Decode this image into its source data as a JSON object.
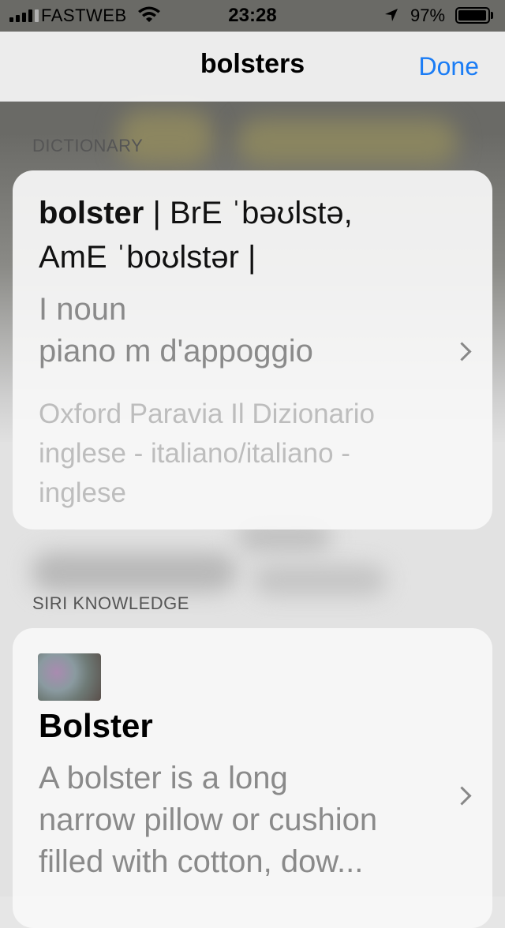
{
  "status": {
    "carrier": "FASTWEB",
    "time": "23:28",
    "battery_pct": "97%",
    "battery_level": 0.97
  },
  "nav": {
    "title": "bolsters",
    "done": "Done"
  },
  "dictionary": {
    "section": "DICTIONARY",
    "headword": "bolster",
    "pron1": "| BrE ˈbəʊlstə,",
    "pron2": "AmE ˈboʊlstər |",
    "pos": "I noun",
    "translation": "piano m d'appoggio",
    "source1": "Oxford Paravia  Il Dizionario",
    "source2": "inglese - italiano/italiano -",
    "source3": "inglese"
  },
  "siri": {
    "section": "SIRI KNOWLEDGE",
    "title": "Bolster",
    "line1": "A bolster is a long",
    "line2": "narrow pillow or cushion",
    "line3": "filled with cotton, dow..."
  }
}
